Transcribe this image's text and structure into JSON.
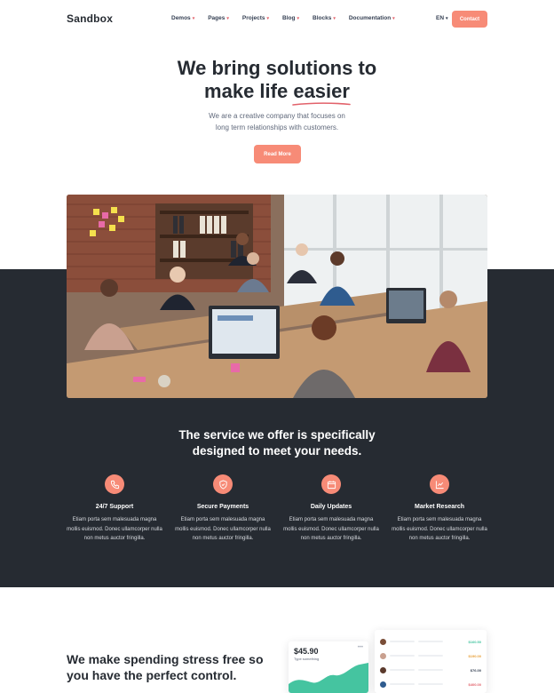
{
  "nav": {
    "brand": "Sandbox",
    "menu": [
      "Demos",
      "Pages",
      "Projects",
      "Blog",
      "Blocks",
      "Documentation"
    ],
    "language": "EN",
    "contact_label": "Contact"
  },
  "hero": {
    "title_line1": "We bring solutions to",
    "title_line2_prefix": "make life",
    "title_line2_highlight": "easier",
    "subtitle_line1": "We are a creative company that focuses on",
    "subtitle_line2": "long term relationships with customers.",
    "cta_label": "Read More"
  },
  "services": {
    "title_line1": "The service we offer is specifically",
    "title_line2": "designed to meet your needs.",
    "items": [
      {
        "icon": "phone-icon",
        "name": "24/7 Support",
        "text": "Etiam porta sem malesuada magna mollis euismod. Donec ullamcorper nulla non metus auctor fringilla."
      },
      {
        "icon": "shield-icon",
        "name": "Secure Payments",
        "text": "Etiam porta sem malesuada magna mollis euismod. Donec ullamcorper nulla non metus auctor fringilla."
      },
      {
        "icon": "calendar-icon",
        "name": "Daily Updates",
        "text": "Etiam porta sem malesuada magna mollis euismod. Donec ullamcorper nulla non metus auctor fringilla."
      },
      {
        "icon": "chart-icon",
        "name": "Market Research",
        "text": "Etiam porta sem malesuada magna mollis euismod. Donec ullamcorper nulla non metus auctor fringilla."
      }
    ]
  },
  "bottom": {
    "title_line1": "We make spending stress free so",
    "title_line2": "you have the perfect control.",
    "balance_card": {
      "amount": "$45.90",
      "caption": "Type something"
    },
    "transactions": [
      {
        "amount": "$160.50",
        "color": "#45c4a0"
      },
      {
        "amount": "$190.00",
        "color": "#e8a03a"
      },
      {
        "amount": "$76.00",
        "color": "#343f52"
      },
      {
        "amount": "$400.00",
        "color": "#e2626b"
      }
    ]
  },
  "colors": {
    "accent": "#f78b77",
    "dark": "#262b32",
    "underline": "#e2626b"
  }
}
